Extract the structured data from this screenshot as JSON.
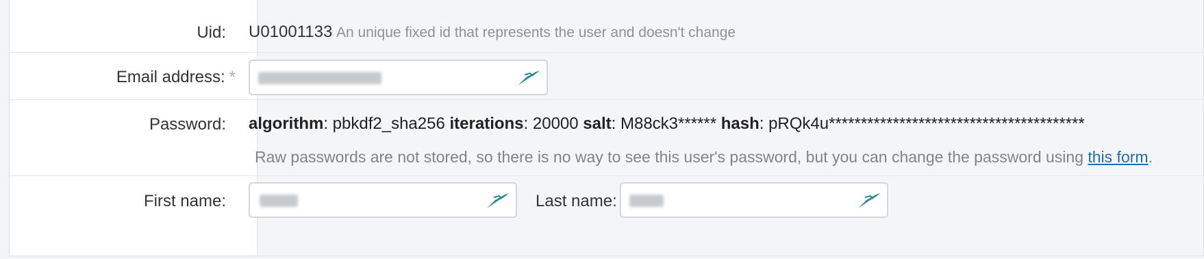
{
  "fields": {
    "uid": {
      "label": "Uid:",
      "value": "U01001133",
      "help": "An unique fixed id that represents the user and doesn't change"
    },
    "email": {
      "label": "Email address:",
      "required_mark": "*",
      "value": ""
    },
    "password": {
      "label": "Password:",
      "algorithm_key": "algorithm",
      "algorithm_value": ": pbkdf2_sha256 ",
      "iterations_key": "iterations",
      "iterations_value": ": 20000 ",
      "salt_key": "salt",
      "salt_value": ": M88ck3****** ",
      "hash_key": "hash",
      "hash_value": ": pRQk4u****************************************",
      "note_text": "Raw passwords are not stored, so there is no way to see this user's password, but you can change the password using ",
      "note_link": "this form",
      "note_end": "."
    },
    "first_name": {
      "label": "First name:",
      "value": ""
    },
    "last_name": {
      "label": "Last name:",
      "value": ""
    }
  },
  "icons": {
    "input_icon": "pen-icon"
  }
}
